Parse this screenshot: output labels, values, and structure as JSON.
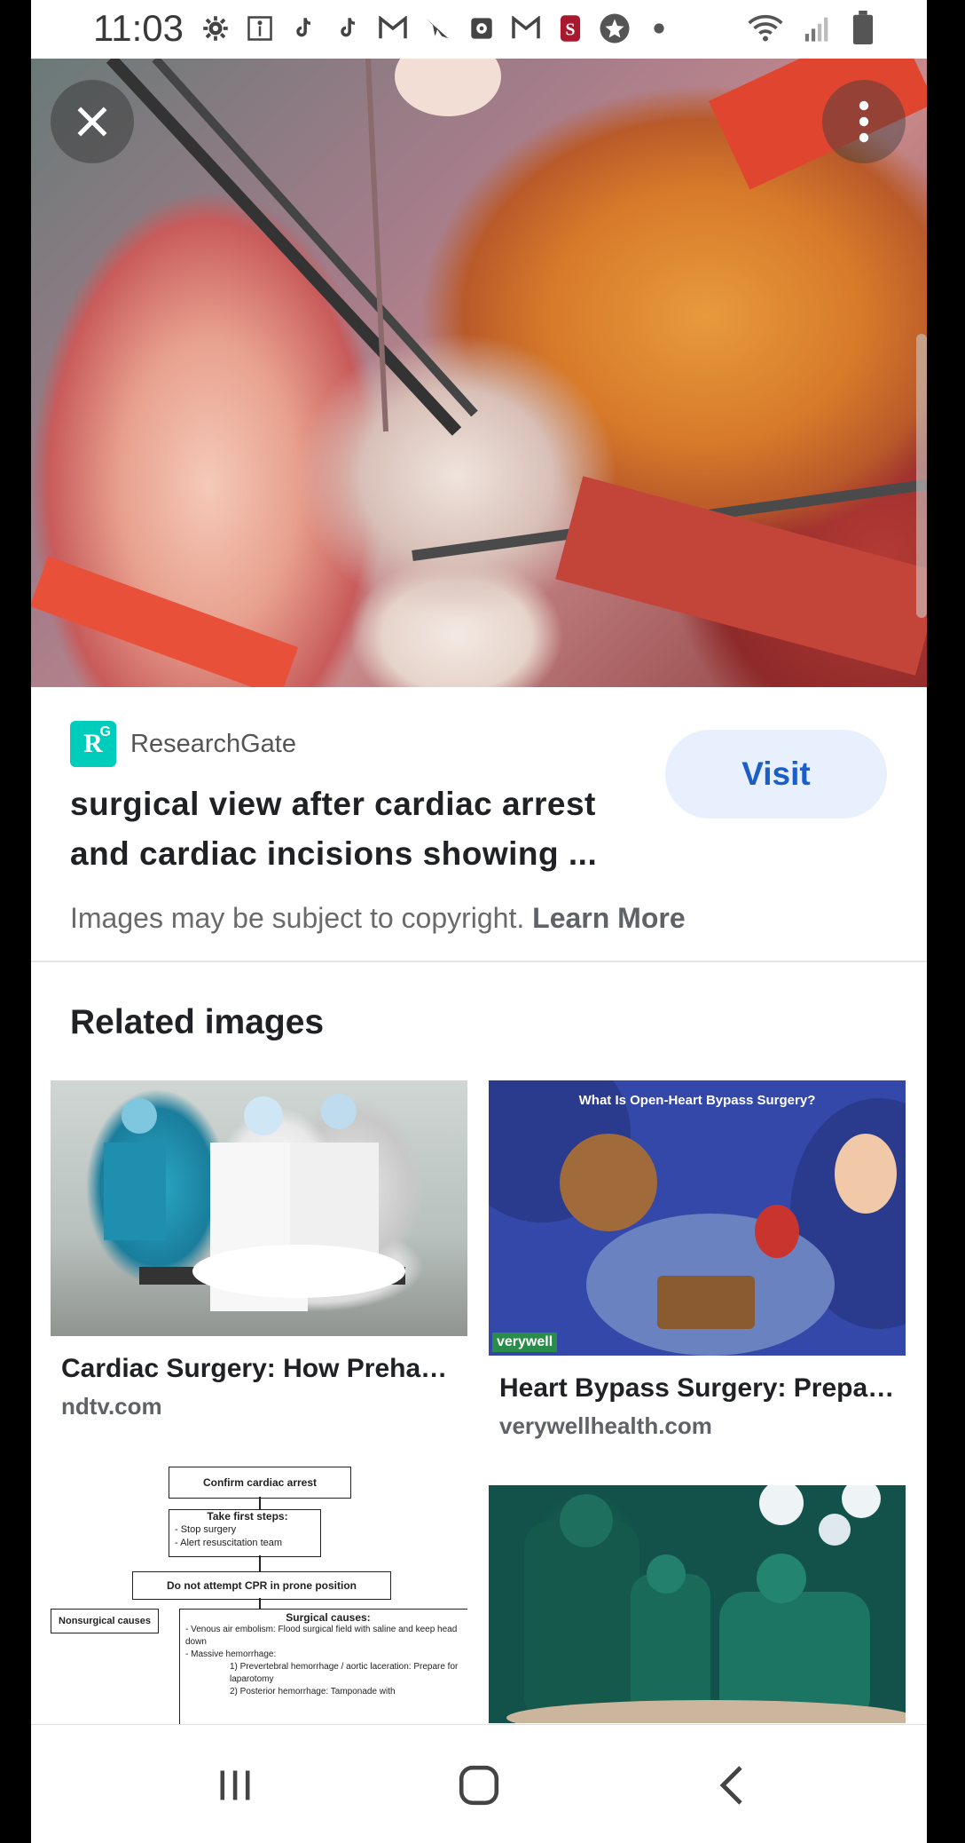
{
  "status_bar": {
    "time": "11:03",
    "icons": [
      "settings-icon",
      "accessibility-icon",
      "tiktok-icon",
      "tiktok-icon",
      "gmail-icon",
      "send-icon",
      "calendar-icon",
      "gmail-icon",
      "stanford-icon",
      "star-icon",
      "dot-icon"
    ],
    "right_icons": [
      "wifi-icon",
      "signal-icon",
      "battery-icon"
    ]
  },
  "viewer": {
    "close_icon": "close-icon",
    "more_icon": "more-vert-icon"
  },
  "result": {
    "source": "ResearchGate",
    "source_logo_text": "R",
    "source_logo_sup": "G",
    "title": "surgical view after cardiac arrest and cardiac incisions showing ...",
    "visit_label": "Visit",
    "copyright_text": "Images may be subject to copyright.",
    "learn_more_label": "Learn More"
  },
  "related": {
    "heading": "Related images",
    "items": [
      {
        "caption": "Cardiac Surgery: How Prehab…",
        "domain": "ndtv.com"
      },
      {
        "caption": "Heart Bypass Surgery: Prepar…",
        "domain": "verywellhealth.com",
        "banner": "What Is Open-Heart Bypass Surgery?",
        "logo": "verywell"
      },
      {
        "flow": [
          "Confirm cardiac arrest",
          "Take first steps:",
          "- Stop surgery",
          "- Alert resuscitation team",
          "Do not attempt CPR in prone position",
          "Nonsurgical causes",
          "Surgical causes:",
          "- Venous air embolism: Flood surgical field with saline and keep head down",
          "- Massive hemorrhage:",
          "1)   Prevertebral hemorrhage / aortic laceration: Prepare for laparotomy",
          "2)   Posterior hemorrhage: Tamponade with"
        ]
      },
      {}
    ]
  },
  "nav": {
    "recents_icon": "recents-icon",
    "home_icon": "home-icon",
    "back_icon": "back-icon"
  }
}
